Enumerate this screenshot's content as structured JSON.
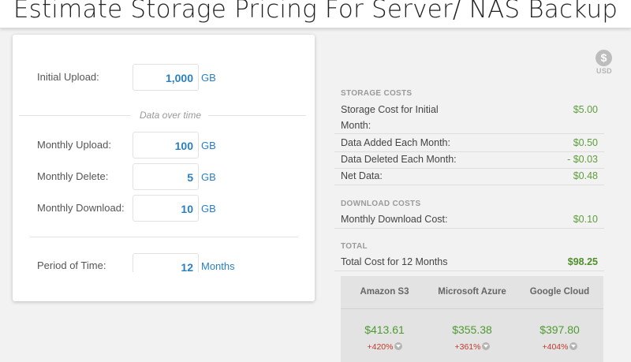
{
  "page": {
    "title": "Estimate Storage Pricing For Server/ NAS Backup"
  },
  "inputs": {
    "initial_upload": {
      "label": "Initial Upload:",
      "value": "1,000",
      "unit": "GB"
    },
    "divider_text": "Data over time",
    "monthly_upload": {
      "label": "Monthly Upload:",
      "value": "100",
      "unit": "GB"
    },
    "monthly_delete": {
      "label": "Monthly Delete:",
      "value": "5",
      "unit": "GB"
    },
    "monthly_download": {
      "label": "Monthly Download:",
      "value": "10",
      "unit": "GB"
    },
    "period": {
      "label": "Period of Time:",
      "value": "12",
      "unit": "Months"
    }
  },
  "currency": {
    "symbol": "$",
    "code": "USD"
  },
  "storage_costs": {
    "header": "STORAGE COSTS",
    "initial_line1": "Storage Cost for Initial",
    "initial_line2": "Month:",
    "initial_value": "$5.00",
    "added_label": "Data Added Each Month:",
    "added_value": "$0.50",
    "deleted_label": "Data Deleted Each Month:",
    "deleted_value": "- $0.03",
    "net_label": "Net Data:",
    "net_value": "$0.48"
  },
  "download_costs": {
    "header": "DOWNLOAD COSTS",
    "monthly_label": "Monthly Download Cost:",
    "monthly_value": "$0.10"
  },
  "total": {
    "header": "TOTAL",
    "label": "Total Cost for 12 Months",
    "value": "$98.25"
  },
  "comparison": [
    {
      "provider": "Amazon S3",
      "price": "$413.61",
      "pct": "+420%"
    },
    {
      "provider": "Microsoft Azure",
      "price": "$355.38",
      "pct": "+361%"
    },
    {
      "provider": "Google Cloud",
      "price": "$397.80",
      "pct": "+404%"
    }
  ],
  "colors": {
    "accent_blue": "#2a7fbf",
    "cost_green": "#5e9e3b",
    "pct_red": "#c0392b"
  }
}
